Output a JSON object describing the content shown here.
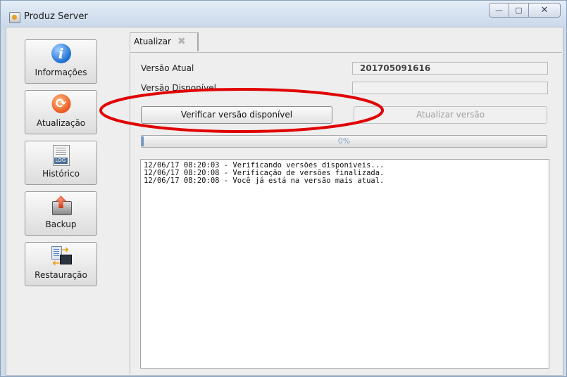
{
  "window": {
    "title": "Produz Server",
    "controls": {
      "minimize": "—",
      "maximize": "▢",
      "close": "✕"
    }
  },
  "sidebar": {
    "items": [
      {
        "label": "Informações",
        "icon": "info-icon"
      },
      {
        "label": "Atualização",
        "icon": "update-icon"
      },
      {
        "label": "Histórico",
        "icon": "log-icon",
        "icon_text": "LOG"
      },
      {
        "label": "Backup",
        "icon": "backup-icon"
      },
      {
        "label": "Restauração",
        "icon": "restore-icon"
      }
    ]
  },
  "tab": {
    "label": "Atualizar",
    "close": "✖"
  },
  "form": {
    "current_label": "Versão Atual",
    "current_value": "201705091616",
    "available_label": "Versão Disponível",
    "available_value": "",
    "check_button": "Verificar versão disponível",
    "update_button": "Atualizar versão"
  },
  "progress": {
    "value": 0,
    "text": "0%"
  },
  "log": {
    "lines": [
      "12/06/17 08:20:03 - Verificando versões disponiveis...",
      "12/06/17 08:20:08 - Verificação de versões finalizada.",
      "12/06/17 08:20:08 - Você já está na versão mais atual."
    ]
  },
  "colors": {
    "annotation": "#e00000",
    "progress_fill": "#7fb2e6",
    "update_icon": "#e9561d",
    "info_icon": "#1f6fd1"
  }
}
